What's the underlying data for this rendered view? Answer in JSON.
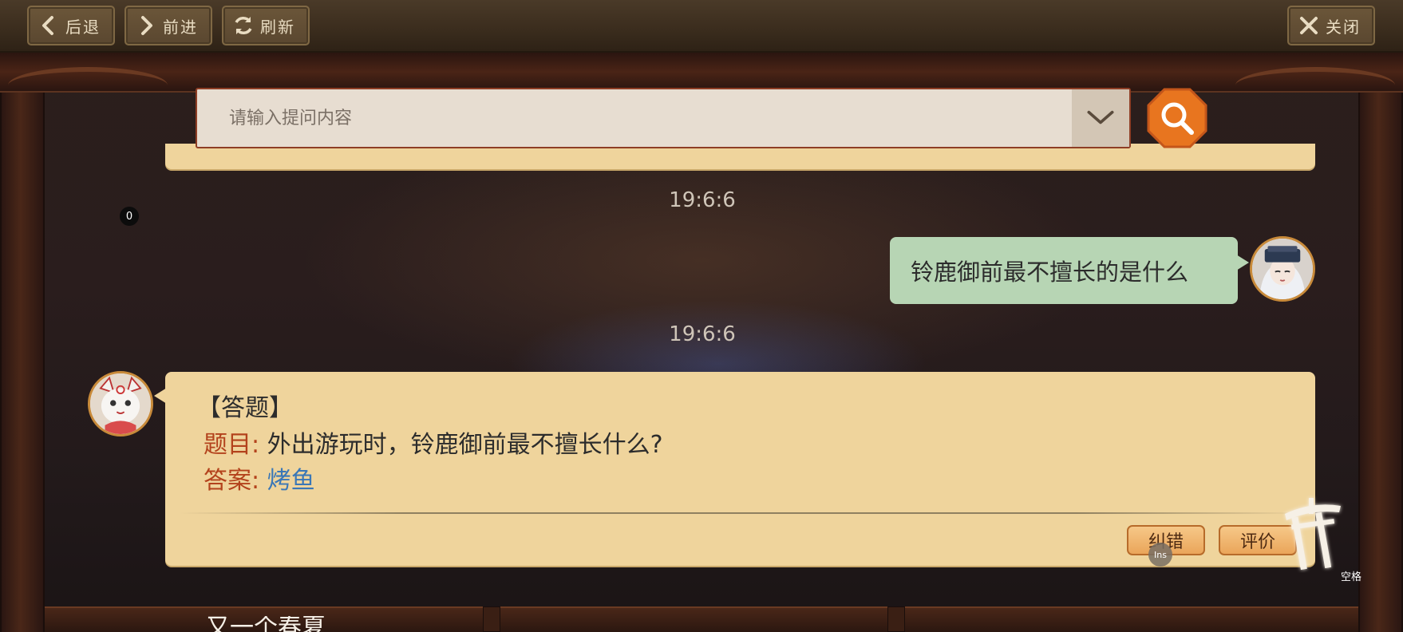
{
  "nav": {
    "back_label": "后退",
    "forward_label": "前进",
    "refresh_label": "刷新",
    "close_label": "关闭"
  },
  "search": {
    "placeholder": "请输入提问内容",
    "value": ""
  },
  "chat": {
    "badge_count": "0",
    "messages": [
      {
        "time": "19:6:6",
        "sender": "user",
        "text": "铃鹿御前最不擅长的是什么"
      },
      {
        "time": "19:6:6",
        "sender": "bot",
        "tag": "【答题】",
        "question_label": "题目:",
        "question_text": "外出游玩时，铃鹿御前最不擅长什么?",
        "answer_label": "答案:",
        "answer_text": "烤鱼",
        "correct_button": "纠错",
        "rate_button": "评价"
      }
    ]
  },
  "overlay": {
    "ins_hint": "Ins",
    "space_hint": "空格"
  },
  "bottom_text": "又一个春夏",
  "colors": {
    "accent_orange": "#e8751f",
    "label_red": "#b3421c",
    "answer_blue": "#3a77b7",
    "bubble_bot": "#efd49c",
    "bubble_user": "#b7d5b4"
  }
}
